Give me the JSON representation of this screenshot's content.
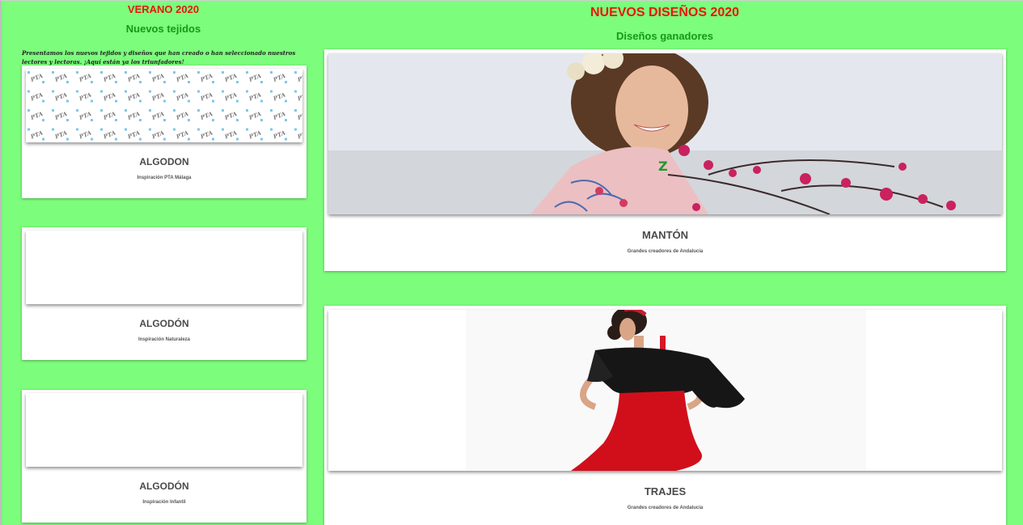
{
  "left": {
    "title": "VERANO 2020",
    "subtitle": "Nuevos tejidos",
    "intro": "Presentamos los nuevos tejidos y diseños que han creado o han seleccionado nuestros lectores y lectoras. ¡Aquí están ya los triunfadores!",
    "pta_mark": "PTA",
    "cards": [
      {
        "title": "ALGODON",
        "subtitle": "Inspiración PTA Málaga"
      },
      {
        "title": "ALGODÓN",
        "subtitle": "Inspiración Naturaleza"
      },
      {
        "title": "ALGODÓN",
        "subtitle": "Inspiración Infantil"
      }
    ]
  },
  "right": {
    "title": "NUEVOS DISEÑOS 2020",
    "subtitle": "Diseños ganadores",
    "cards": [
      {
        "title": "MANTÓN",
        "subtitle": "Grandes creadores de Andalucía"
      },
      {
        "title": "TRAJES",
        "subtitle": "Grandes creadores de Andalucía"
      }
    ]
  },
  "colors": {
    "background": "#7cfd7c",
    "title_red": "#e8170c",
    "title_green": "#149a14"
  }
}
